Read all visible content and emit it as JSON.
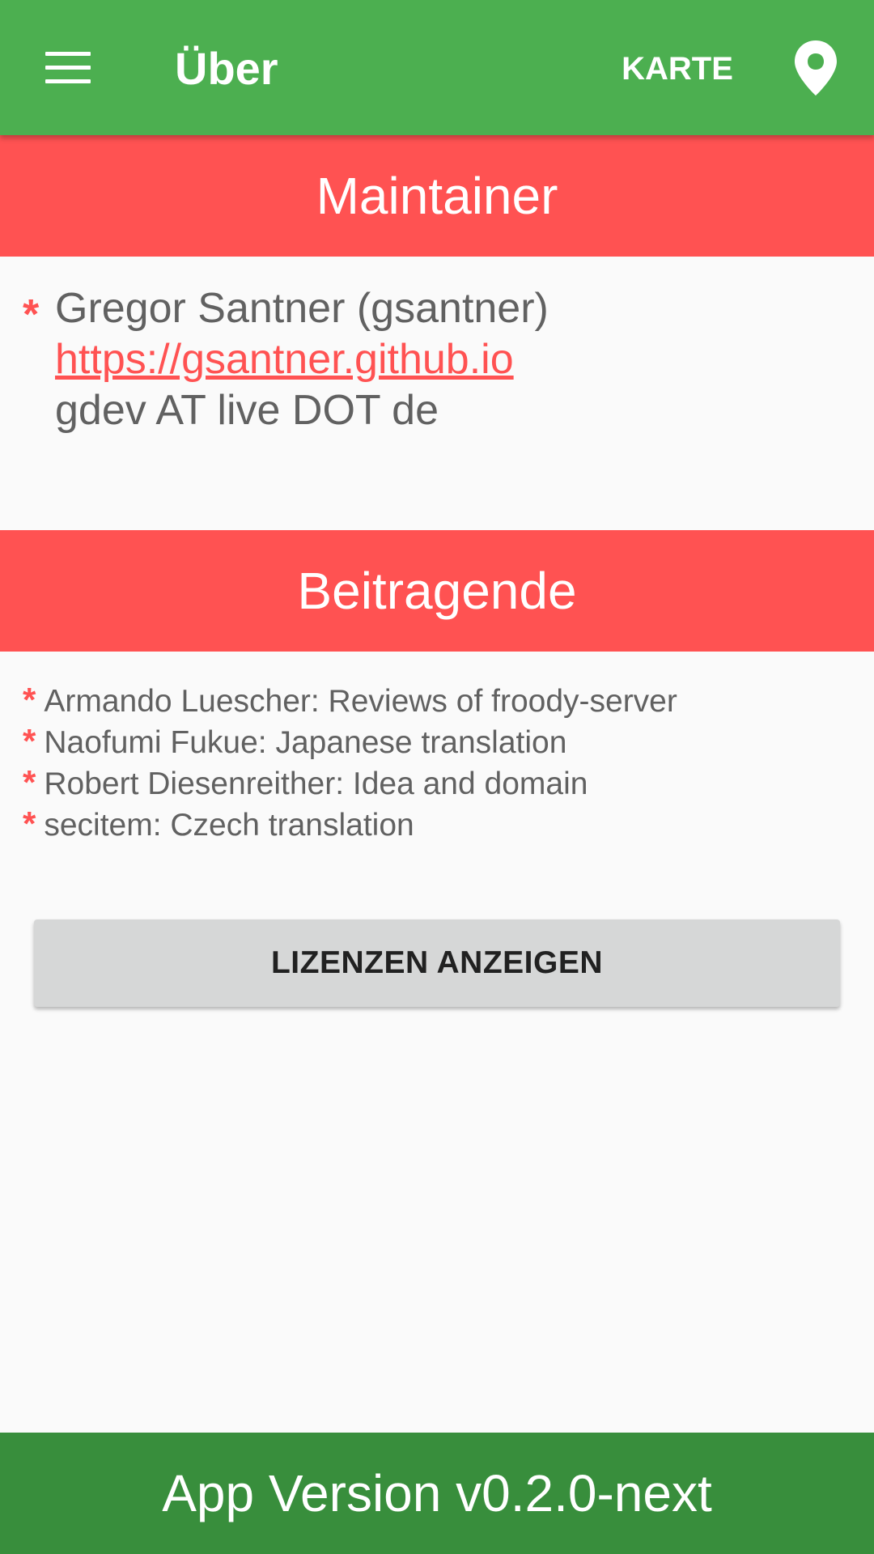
{
  "appbar": {
    "title": "Über",
    "map_action_label": "KARTE",
    "menu_icon": "hamburger-menu-icon",
    "map_pin_icon": "map-pin-icon",
    "color": "#4caf50"
  },
  "maintainer": {
    "header": "Maintainer",
    "bullet": "*",
    "name": "Gregor Santner (gsantner)",
    "website": "https://gsantner.github.io",
    "email": "gdev AT live DOT de"
  },
  "contributors": {
    "header": "Beitragende",
    "bullet": "*",
    "items": [
      "Armando Luescher: Reviews of froody-server",
      "Naofumi Fukue: Japanese translation",
      "Robert Diesenreither: Idea and domain",
      "secitem: Czech translation"
    ]
  },
  "licenses_button_label": "LIZENZEN ANZEIGEN",
  "footer": {
    "version_text": "App Version v0.2.0-next",
    "color": "#388e3c"
  },
  "accent_color": "#ff5252"
}
